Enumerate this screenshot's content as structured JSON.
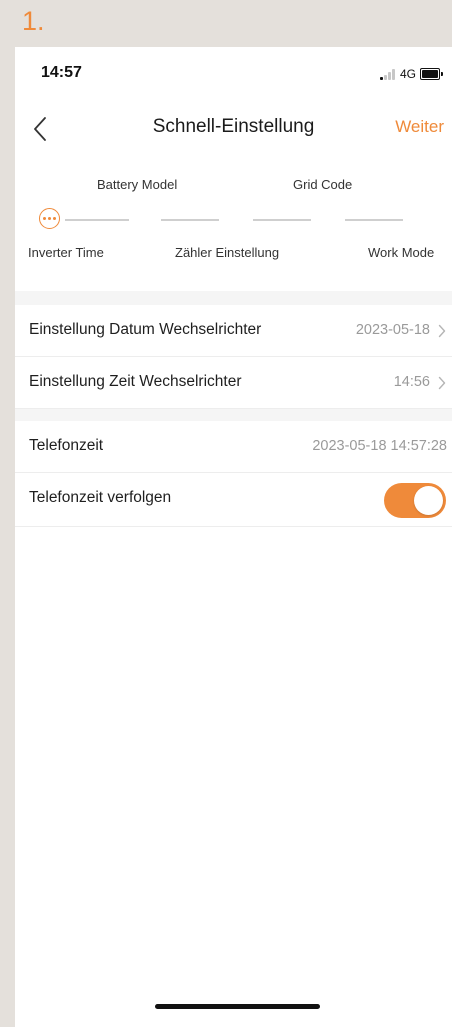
{
  "step_label": "1.",
  "status_bar": {
    "time": "14:57",
    "network": "4G"
  },
  "nav": {
    "title": "Schnell-Einstellung",
    "next_label": "Weiter"
  },
  "steps": {
    "top_labels": [
      "Battery Model",
      "Grid Code"
    ],
    "bottom_labels": [
      "Inverter Time",
      "Zähler Einstellung",
      "Work Mode"
    ],
    "active_step": "Inverter Time"
  },
  "settings": {
    "inverter_date": {
      "label": "Einstellung Datum Wechselrichter",
      "value": "2023-05-18"
    },
    "inverter_time": {
      "label": "Einstellung Zeit Wechselrichter",
      "value": "14:56"
    },
    "phone_time": {
      "label": "Telefonzeit",
      "value": "2023-05-18 14:57:28"
    },
    "follow_phone_time": {
      "label": "Telefonzeit verfolgen",
      "enabled": true
    }
  },
  "colors": {
    "accent": "#ef8a3a",
    "background": "#e4e0db",
    "muted_text": "#9a9a9a"
  },
  "icons": {
    "back": "chevron-left-icon",
    "row_arrow": "chevron-right-icon",
    "step_active": "more-dots-icon"
  }
}
